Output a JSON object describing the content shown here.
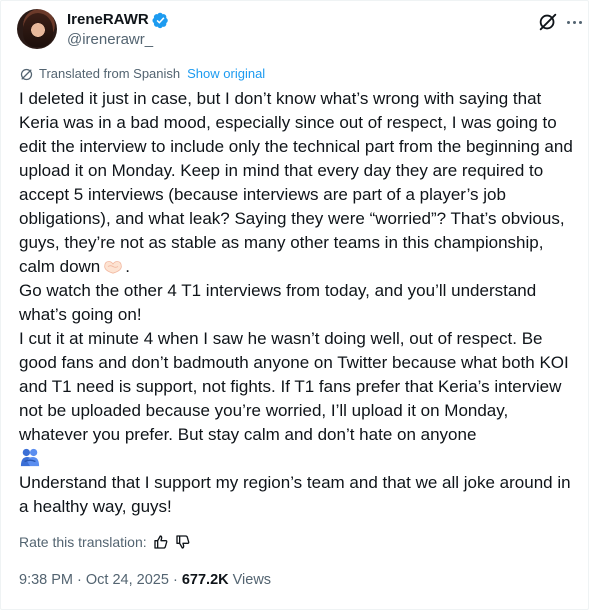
{
  "author": {
    "display_name": "IreneRAWR",
    "handle": "@irenerawr_",
    "verified": true
  },
  "icons": {
    "avatar": "profile-photo",
    "verified": "verified-badge-icon",
    "grok": "grok-icon",
    "more": "more-options-icon",
    "translate": "translate-icon",
    "thumbs_up": "thumbs-up-icon",
    "thumbs_down": "thumbs-down-icon",
    "heart_emoji": "handshake-heart-emoji",
    "hug_emoji": "people-hugging-emoji"
  },
  "colors": {
    "accent": "#1d9bf0",
    "text": "#0f1419",
    "secondary": "#536471"
  },
  "translation": {
    "label": "Translated from Spanish",
    "show_original": "Show original"
  },
  "post": {
    "p1": "I deleted it just in case, but I don’t know what’s wrong with saying that Keria was in a bad mood, especially since out of respect, I was going to edit the interview to include only the technical part from the beginning and upload it on Monday. Keep in mind that every day they are required to accept 5 interviews (because interviews are part of a player’s job obligations), and what leak? Saying they were “worried”? That’s obvious, guys, they’re not as stable as many other teams in this championship, calm down",
    "p1_end": ".",
    "p2": "Go watch the other 4 T1 interviews from today, and you’ll understand what’s going on!",
    "p3": "I cut it at minute 4 when I saw he wasn’t doing well, out of respect. Be good fans and don’t badmouth anyone on Twitter because what both KOI and T1 need is support, not fights. If T1 fans prefer that Keria’s interview not be uploaded because you’re worried, I’ll upload it on Monday, whatever you prefer. But stay calm and don’t hate on anyone",
    "p4": "Understand that I support my region’s team and that we all joke around in a healthy way, guys!"
  },
  "rate": {
    "label": "Rate this translation:"
  },
  "meta": {
    "time": "9:38 PM",
    "separator": "·",
    "date": "Oct 24, 2025",
    "views_count": "677.2K",
    "views_label": "Views"
  }
}
